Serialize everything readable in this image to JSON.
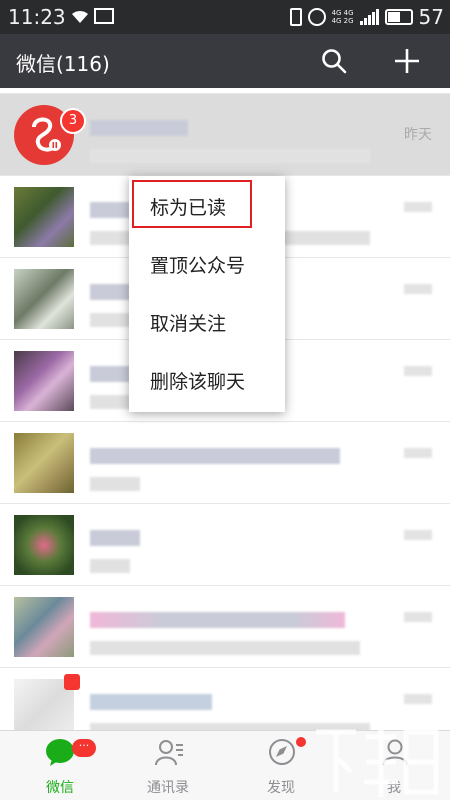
{
  "status_bar": {
    "time": "11:23",
    "network_top": "4G 4G",
    "network_bottom": "4G 2G",
    "battery": "57"
  },
  "title_bar": {
    "title": "微信(116)",
    "search_icon": "search-icon",
    "add_icon": "plus-icon"
  },
  "chat_list": {
    "highlighted_row": {
      "time": "昨天",
      "unread_count": "3"
    }
  },
  "context_menu": {
    "items": [
      "标为已读",
      "置顶公众号",
      "取消关注",
      "删除该聊天"
    ],
    "highlight_color": "#e02020"
  },
  "tab_bar": {
    "tabs": [
      {
        "label": "微信",
        "icon": "chat-bubble-icon",
        "badge": "···"
      },
      {
        "label": "通讯录",
        "icon": "contacts-icon"
      },
      {
        "label": "发现",
        "icon": "compass-icon"
      },
      {
        "label": "我",
        "icon": "person-icon"
      }
    ],
    "active_color": "#1aad19",
    "inactive_color": "#8e8e93"
  },
  "colors": {
    "status_bar_bg": "#2a2b2d",
    "title_bar_bg": "#393a3f",
    "badge_red": "#f43530"
  }
}
